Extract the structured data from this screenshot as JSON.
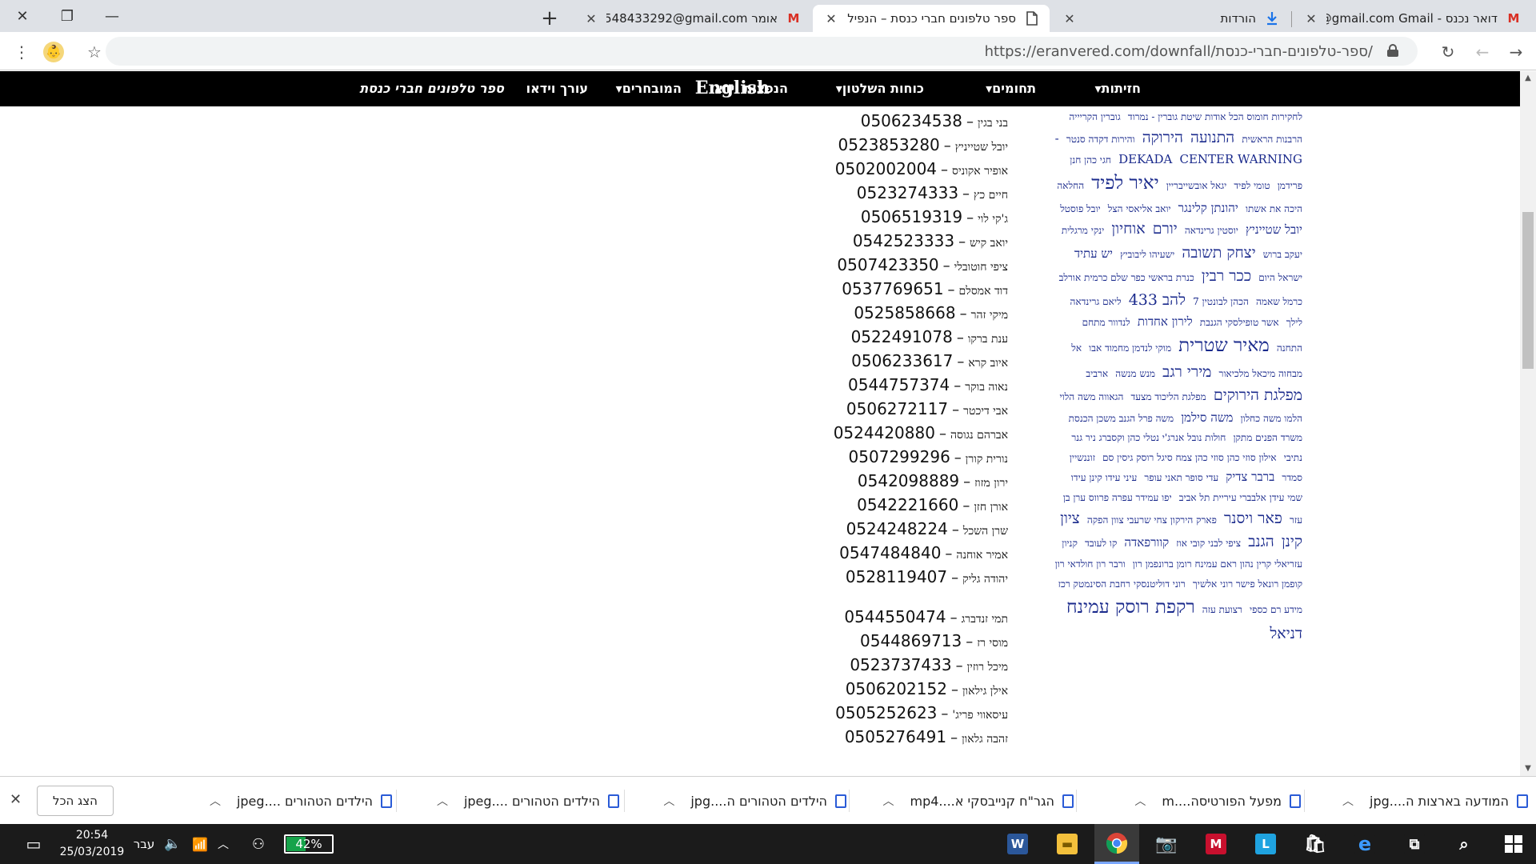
{
  "browser": {
    "tabs": [
      {
        "title": "דואר נכנס - Gmail ‏‎0@gmail.com",
        "favicon": "gmail-icon"
      },
      {
        "title": "הורדות",
        "favicon": "download-icon"
      },
      {
        "title": "ספר טלפונים חברי כנסת – הנפילה",
        "favicon": "page-icon"
      },
      {
        "title": "אומר A0548433292@gmail.com...",
        "favicon": "gmail-icon"
      }
    ],
    "url": "https://eranvered.com/downfall/ספר-טלפונים-חברי-כנסת/"
  },
  "site_nav": {
    "items": [
      "חזיתות",
      "תחומים",
      "כוחות השלטון",
      "הנפצות וידאו",
      "English",
      "המובחרים",
      "עורך וידאו",
      "ספר טלפונים חברי כנסת"
    ]
  },
  "phonebook": [
    {
      "name": "בני בגין",
      "number": "0506234538"
    },
    {
      "name": "יובל שטייניץ",
      "number": "0523853280"
    },
    {
      "name": "אופיר אקוניס",
      "number": "0502002004"
    },
    {
      "name": "חיים כץ",
      "number": "0523274333"
    },
    {
      "name": "ג'קי לוי",
      "number": "0506519319"
    },
    {
      "name": "יואב קיש",
      "number": "0542523333"
    },
    {
      "name": "ציפי חוטובלי",
      "number": "0507423350"
    },
    {
      "name": "דוד אמסלם",
      "number": "0537769651"
    },
    {
      "name": "מיקי זהר",
      "number": "0525858668"
    },
    {
      "name": "ענת ברקו",
      "number": "0522491078"
    },
    {
      "name": "איוב קרא",
      "number": "0506233617"
    },
    {
      "name": "נאוה בוקר",
      "number": "0544757374"
    },
    {
      "name": "אבי דיכטר",
      "number": "0506272117"
    },
    {
      "name": "אברהם נגוסה",
      "number": "0524420880"
    },
    {
      "name": "נורית קורן",
      "number": "0507299296"
    },
    {
      "name": "ירון מזוז",
      "number": "0542098889"
    },
    {
      "name": "אורן חזן",
      "number": "0542221660"
    },
    {
      "name": "שרן השכל",
      "number": "0524248224"
    },
    {
      "name": "אמיר אוחנה",
      "number": "0547484840"
    },
    {
      "name": "יהודה גליק",
      "number": "0528119407"
    },
    {
      "name": "תמי זנדברג",
      "number": "0544550474"
    },
    {
      "name": "מוסי רז",
      "number": "0544869713"
    },
    {
      "name": "מיכל רוזין",
      "number": "0523737433"
    },
    {
      "name": "אילן גילאון",
      "number": "0506202152"
    },
    {
      "name": "עיסאווי פריג'",
      "number": "0505252623"
    },
    {
      "name": "זהבה גלאון",
      "number": "0505276491"
    }
  ],
  "tag_cloud": [
    [
      "לחקירות חומוס הכל אודות שיטת גוברין - נמרוד",
      1
    ],
    [
      "גוברין הקריייה הרבנות הראשית",
      1
    ],
    [
      "התנועה",
      3
    ],
    [
      "הירוקה",
      3
    ],
    [
      "והירות דקדה סנטר",
      1
    ],
    [
      "- DEKADA",
      2
    ],
    [
      "CENTER WARNING",
      2
    ],
    [
      "חגי כהן חנן פרידמן",
      1
    ],
    [
      "טומי לפיד",
      1
    ],
    [
      "יגאל אובשייבריין",
      1
    ],
    [
      "יאיר לפיד",
      4
    ],
    [
      "החלאה היכה את אשתו",
      1
    ],
    [
      "יהונתן קלינגר",
      2
    ],
    [
      "יואב אליאסי הצל",
      1
    ],
    [
      "יובל פוסטל",
      1
    ],
    [
      "יובל שטייניץ",
      2
    ],
    [
      "יוסטין גרינדאה",
      1
    ],
    [
      "יורם",
      3
    ],
    [
      "אוחיון",
      3
    ],
    [
      "ינקי מרגלית יעקב ברוש",
      1
    ],
    [
      "יצחק תשובה",
      3
    ],
    [
      "ישעיהו ליבוביץ",
      1
    ],
    [
      "יש עתיד",
      2
    ],
    [
      "ישראל היום",
      1
    ],
    [
      "ככר רבין",
      3
    ],
    [
      "כנרת בראשי כפר שלם כרמית אורלב כרמל שאמה",
      1
    ],
    [
      "הכהן לבונטין 7",
      1
    ],
    [
      "להב 433",
      3
    ],
    [
      "ליאם גרינדאה לילך",
      1
    ],
    [
      "אשר טופילסקי הגנבת",
      1
    ],
    [
      "לירון אחדות",
      2
    ],
    [
      "לנדוור מתחם",
      1
    ],
    [
      "התחנה",
      1
    ],
    [
      "מאיר שטרית",
      4
    ],
    [
      "מוקי לנדמן מחמוד אבו",
      1
    ],
    [
      "אל מבחוה מיכאל מלכיאור",
      1
    ],
    [
      "מירי רגב",
      3
    ],
    [
      "מנש מנשה",
      1
    ],
    [
      "ארביב",
      1
    ],
    [
      "מפלגת הירוקים",
      3
    ],
    [
      "מפלגת הליכוד מצעד",
      1
    ],
    [
      "הגאווה משה הלוי הלמו משה כחלון",
      1
    ],
    [
      "משה סילמן",
      2
    ],
    [
      "משה פרל הגנב משכן הכנסת משרד הפנים מתקן",
      1
    ],
    [
      "חולות נובל אנרג'י נטלי כהן וקסברג ניר גנר נתיבי",
      1
    ],
    [
      "אילון סוזי כהן סוזי כהן צמח סיגל רוסק גיסין סם",
      1
    ],
    [
      "זוננשיין סמדר",
      1
    ],
    [
      "ברבר צדיק",
      2
    ],
    [
      "עדי סופר תאני עופר",
      1
    ],
    [
      "עיני עידו קינן עידו שמי עידן אלבברי עיריית תל אביב",
      1
    ],
    [
      "יפו עמידר עפרה פרווס ערן בן עזר",
      1
    ],
    [
      "פאר ויסנר",
      3
    ],
    [
      "פארק הירקון צחי שרעבי צוון הפקה",
      1
    ],
    [
      "ציון קינן",
      3
    ],
    [
      "הגנב",
      3
    ],
    [
      "ציפי לבני קובי אוז",
      1
    ],
    [
      "קוורפאדה",
      2
    ],
    [
      "קו לעובד",
      1
    ],
    [
      "קניון עזריאלי קרין נהון ראם עמינח רומן ברונפמן רון",
      1
    ],
    [
      "ורבר רון חולדאי רון קופמן רונאל פישר רוני אלשיך",
      1
    ],
    [
      "רוני דוליטנסקי רחבת הסינמטק רכז מידע רם כספי",
      1
    ],
    [
      "רצועת עזה",
      1
    ],
    [
      "רקפת רוסק עמינח",
      4
    ],
    [
      "דניאל",
      3
    ]
  ],
  "downloads": [
    {
      "name": "המודעה בארצות ה....jpg"
    },
    {
      "name": "מפעל הפורטיסה....m"
    },
    {
      "name": "הגר\"ח קנייבסקי א....mp4"
    },
    {
      "name": "הילדים הטהורים ה....jpg"
    },
    {
      "name": "הילדים הטהורים ....jpeg"
    },
    {
      "name": "הילדים הטהורים ....jpeg"
    }
  ],
  "download_shelf": {
    "show_all": "הצג הכל"
  },
  "taskbar": {
    "time": "20:54",
    "date": "25/03/2019",
    "language": "עבר",
    "battery": "42%",
    "battery_level": 0.42
  },
  "colors": {
    "nav_bg": "#000000",
    "cloud_link": "#1a2a8c",
    "battery": "#16a34a",
    "gmail": "#d93025"
  }
}
